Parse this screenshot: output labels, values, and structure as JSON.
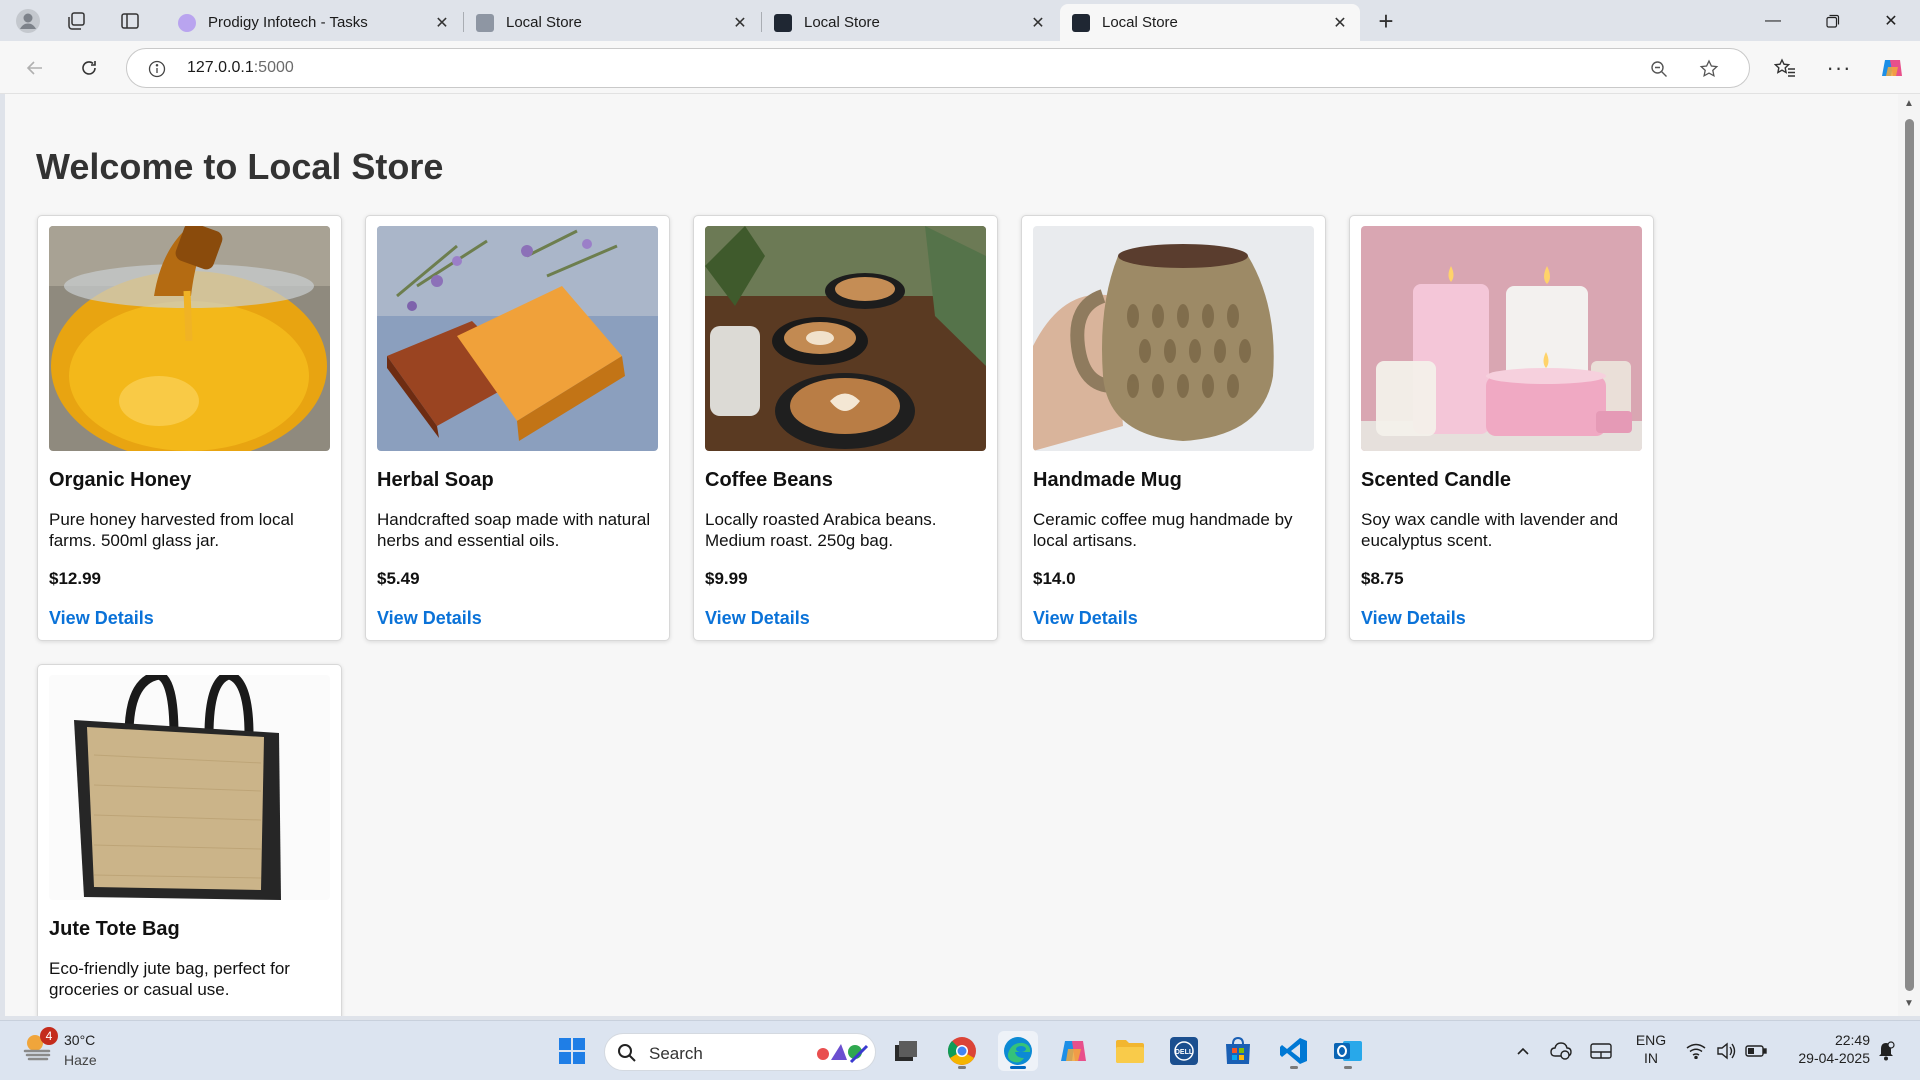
{
  "browser": {
    "tabs": [
      {
        "label": "Prodigy Infotech - Tasks",
        "active": false
      },
      {
        "label": "Local Store",
        "active": false
      },
      {
        "label": "Local Store",
        "active": false
      },
      {
        "label": "Local Store",
        "active": true
      }
    ],
    "url_host": "127.0.0.1",
    "url_port": ":5000"
  },
  "page": {
    "title": "Welcome to Local Store",
    "link_color": "#0a72d8",
    "products": [
      {
        "name": "Organic Honey",
        "description": "Pure honey harvested from local farms. 500ml glass jar.",
        "price": "$12.99",
        "link": "View Details",
        "image": "honey-jar"
      },
      {
        "name": "Herbal Soap",
        "description": "Handcrafted soap made with natural herbs and essential oils.",
        "price": "$5.49",
        "link": "View Details",
        "image": "soap-bars"
      },
      {
        "name": "Coffee Beans",
        "description": "Locally roasted Arabica beans. Medium roast. 250g bag.",
        "price": "$9.99",
        "link": "View Details",
        "image": "coffee-cups"
      },
      {
        "name": "Handmade Mug",
        "description": "Ceramic coffee mug handmade by local artisans.",
        "price": "$14.0",
        "link": "View Details",
        "image": "ceramic-mug"
      },
      {
        "name": "Scented Candle",
        "description": "Soy wax candle with lavender and eucalyptus scent.",
        "price": "$8.75",
        "link": "View Details",
        "image": "candles"
      },
      {
        "name": "Jute Tote Bag",
        "description": "Eco-friendly jute bag, perfect for groceries or casual use.",
        "image": "tote-bag"
      }
    ]
  },
  "taskbar": {
    "weather": {
      "temp": "30°C",
      "condition": "Haze",
      "badge": "4"
    },
    "search_label": "Search",
    "lang": "ENG",
    "region": "IN",
    "time": "22:49",
    "date": "29-04-2025"
  }
}
